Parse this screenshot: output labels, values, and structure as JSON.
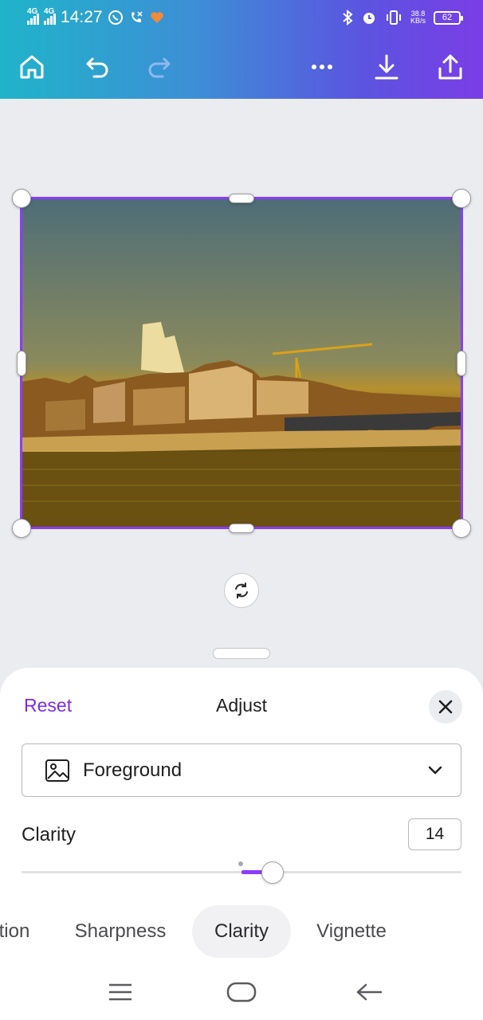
{
  "status_bar": {
    "network_1": "4G",
    "network_2": "4G",
    "time": "14:27",
    "speed_value": "38.8",
    "speed_unit": "KB/s",
    "battery": "62"
  },
  "toolbar": {
    "icons": [
      "home-icon",
      "undo-icon",
      "redo-icon",
      "more-icon",
      "download-icon",
      "share-icon"
    ]
  },
  "editor": {
    "selection_color": "#8b3dff"
  },
  "panel": {
    "reset_label": "Reset",
    "title": "Adjust",
    "dropdown_value": "Foreground",
    "slider_label": "Clarity",
    "slider_value": "14",
    "slider_min": -100,
    "slider_max": 100,
    "slider_level": 14
  },
  "tabs": [
    {
      "label": "tion",
      "active": false
    },
    {
      "label": "Sharpness",
      "active": false
    },
    {
      "label": "Clarity",
      "active": true
    },
    {
      "label": "Vignette",
      "active": false
    }
  ],
  "colors": {
    "accent": "#8b3dff",
    "reset_text": "#7d2ae8",
    "gradient_start": "#1fb4c9",
    "gradient_end": "#7b3de6"
  }
}
